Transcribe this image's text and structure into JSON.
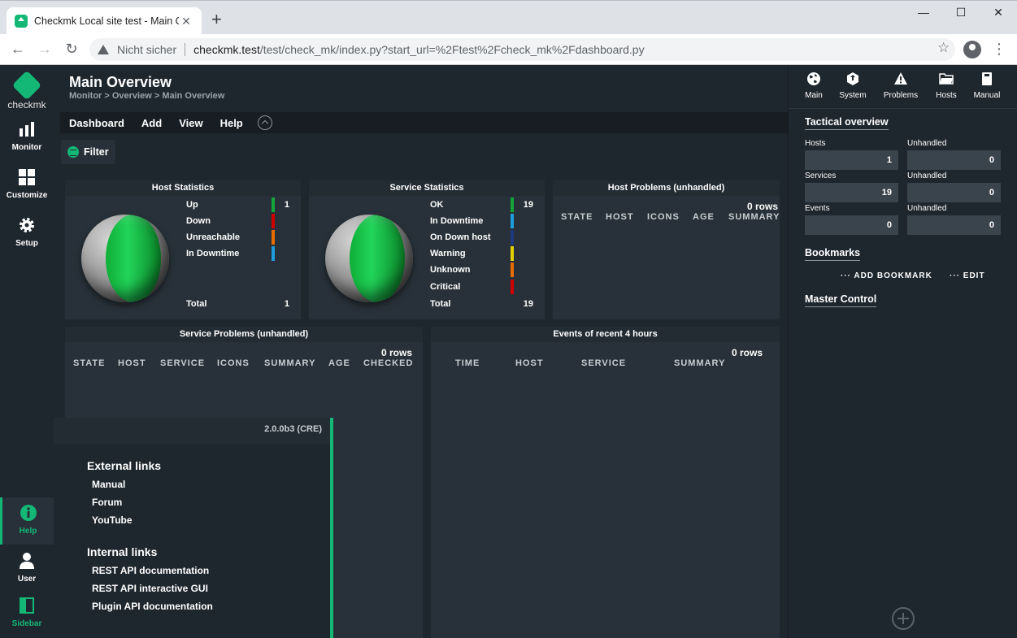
{
  "browser": {
    "tab_title": "Checkmk Local site test - Main O",
    "tab_close": "✕",
    "new_tab": "+",
    "win_min": "—",
    "win_max": "☐",
    "win_close": "✕",
    "insecure_label": "Nicht sicher",
    "url_host": "checkmk.test",
    "url_path": "/test/check_mk/index.py?start_url=%2Ftest%2Fcheck_mk%2Fdashboard.py",
    "back": "←",
    "forward": "→",
    "reload": "↻",
    "star": "☆",
    "menu": "⋮"
  },
  "leftnav": {
    "logo_text": "checkmk",
    "items": [
      {
        "label": "Monitor",
        "icon": "bar-chart-icon"
      },
      {
        "label": "Customize",
        "icon": "grid-icon"
      },
      {
        "label": "Setup",
        "icon": "gear-icon"
      },
      {
        "label": "Help",
        "icon": "info-icon"
      },
      {
        "label": "User",
        "icon": "user-icon"
      },
      {
        "label": "Sidebar",
        "icon": "sidebar-icon"
      }
    ]
  },
  "main": {
    "title": "Main Overview",
    "breadcrumb": "Monitor > Overview > Main Overview",
    "menu": [
      "Dashboard",
      "Add",
      "View",
      "Help"
    ],
    "filter_label": "Filter"
  },
  "host_stats": {
    "title": "Host Statistics",
    "rows": [
      {
        "label": "Up",
        "value": "1",
        "color": "#13a538"
      },
      {
        "label": "Down",
        "value": "",
        "color": "#d00000"
      },
      {
        "label": "Unreachable",
        "value": "",
        "color": "#e86b00"
      },
      {
        "label": "In Downtime",
        "value": "",
        "color": "#1e9ddd"
      }
    ],
    "total_label": "Total",
    "total_value": "1"
  },
  "service_stats": {
    "title": "Service Statistics",
    "rows": [
      {
        "label": "OK",
        "value": "19",
        "color": "#13a538"
      },
      {
        "label": "In Downtime",
        "value": "",
        "color": "#1e9ddd"
      },
      {
        "label": "On Down host",
        "value": "",
        "color": "#1f3a80"
      },
      {
        "label": "Warning",
        "value": "",
        "color": "#e0d000"
      },
      {
        "label": "Unknown",
        "value": "",
        "color": "#e86b00"
      },
      {
        "label": "Critical",
        "value": "",
        "color": "#d00000"
      }
    ],
    "total_label": "Total",
    "total_value": "19"
  },
  "host_problems": {
    "title": "Host Problems (unhandled)",
    "rows": "0 rows",
    "columns": [
      "STATE",
      "HOST",
      "ICONS",
      "AGE",
      "SUMMARY"
    ]
  },
  "service_problems": {
    "title": "Service Problems (unhandled)",
    "rows": "0 rows",
    "columns": [
      "STATE",
      "HOST",
      "SERVICE",
      "ICONS",
      "SUMMARY",
      "AGE",
      "CHECKED"
    ]
  },
  "events": {
    "title": "Events of recent 4 hours",
    "rows": "0 rows",
    "columns": [
      "TIME",
      "HOST",
      "SERVICE",
      "SUMMARY"
    ]
  },
  "help_popup": {
    "version": "2.0.0b3 (CRE)",
    "external_heading": "External links",
    "external_links": [
      "Manual",
      "Forum",
      "YouTube"
    ],
    "internal_heading": "Internal links",
    "internal_links": [
      "REST API documentation",
      "REST API interactive GUI",
      "Plugin API documentation"
    ]
  },
  "sidebar": {
    "tabs": [
      {
        "label": "Main",
        "icon": "globe-icon"
      },
      {
        "label": "System",
        "icon": "cube-icon"
      },
      {
        "label": "Problems",
        "icon": "warning-icon"
      },
      {
        "label": "Hosts",
        "icon": "folder-icon"
      },
      {
        "label": "Manual",
        "icon": "book-icon"
      }
    ],
    "tactical_title": "Tactical overview",
    "tactical": [
      {
        "label": "Hosts",
        "value": "1",
        "unhandled_label": "Unhandled",
        "unhandled": "0"
      },
      {
        "label": "Services",
        "value": "19",
        "unhandled_label": "Unhandled",
        "unhandled": "0"
      },
      {
        "label": "Events",
        "value": "0",
        "unhandled_label": "Unhandled",
        "unhandled": "0"
      }
    ],
    "bookmarks_title": "Bookmarks",
    "add_bookmark": "··· ADD BOOKMARK",
    "edit": "··· EDIT",
    "master_title": "Master Control"
  },
  "colors": {
    "accent": "#14b876",
    "background": "#1e262e",
    "panel": "#283139"
  }
}
